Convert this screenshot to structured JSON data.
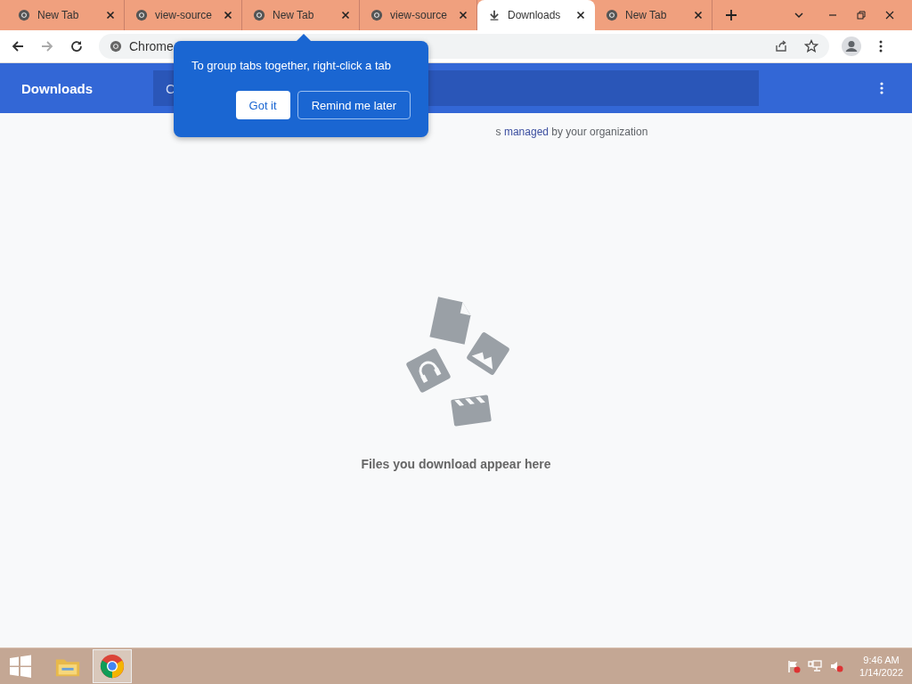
{
  "tabs": [
    {
      "title": "New Tab",
      "kind": "page",
      "selected": false
    },
    {
      "title": "view-source",
      "kind": "page",
      "selected": false
    },
    {
      "title": "New Tab",
      "kind": "page",
      "selected": false
    },
    {
      "title": "view-source",
      "kind": "page",
      "selected": false
    },
    {
      "title": "Downloads",
      "kind": "download",
      "selected": true
    },
    {
      "title": "New Tab",
      "kind": "page",
      "selected": false
    }
  ],
  "omnibox": {
    "text": "Chrome"
  },
  "header": {
    "title": "Downloads",
    "search_text": "C"
  },
  "managed_notice": {
    "before": "s",
    "link": "managed",
    "after": " by your organization"
  },
  "empty_message": "Files you download appear here",
  "popup": {
    "text": "To group tabs together, right-click a tab",
    "buttons": [
      {
        "label": "Got it",
        "kind": "plain"
      },
      {
        "label": "Remind me later",
        "kind": "outline"
      }
    ]
  },
  "taskbar": {
    "apps": [
      {
        "kind": "folder",
        "selected": false
      },
      {
        "kind": "chrome",
        "selected": true
      }
    ],
    "time": "9:46 AM",
    "date": "1/14/2022"
  }
}
